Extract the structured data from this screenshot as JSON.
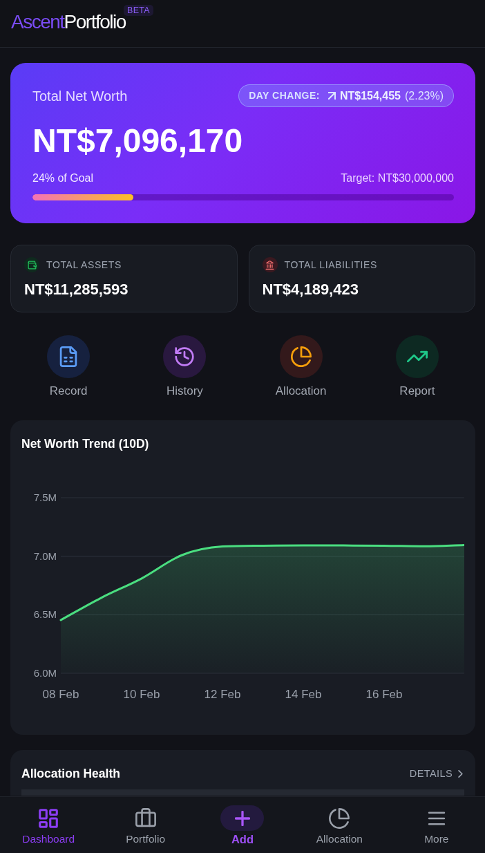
{
  "header": {
    "logo_words": [
      "Ascent",
      "Portfolio"
    ],
    "badge": "BETA"
  },
  "net_worth_card": {
    "label": "Total Net Worth",
    "day_change": {
      "label": "DAY CHANGE:",
      "amount": "NT$154,455",
      "percent": "(2.23%)"
    },
    "value": "NT$7,096,170",
    "goal_label": "24% of Goal",
    "target": "Target: NT$30,000,000",
    "progress": {
      "level": 0.24
    }
  },
  "summary_cards": [
    {
      "kind": "assets",
      "label": "TOTAL ASSETS",
      "value": "NT$11,285,593"
    },
    {
      "kind": "liabilities",
      "label": "TOTAL LIABILITIES",
      "value": "NT$4,189,423"
    }
  ],
  "quick_actions": [
    {
      "kind": "record",
      "label": "Record"
    },
    {
      "kind": "history",
      "label": "History"
    },
    {
      "kind": "allocation",
      "label": "Allocation"
    },
    {
      "kind": "report",
      "label": "Report"
    }
  ],
  "trend_card": {
    "chart_data": {
      "type": "area",
      "title": "Net Worth Trend (10D)",
      "categories": [
        "08 Feb",
        null,
        "10 Feb",
        null,
        "12 Feb",
        null,
        "14 Feb",
        null,
        "16 Feb",
        null,
        null
      ],
      "series": [
        {
          "color": "#4ade80",
          "values": [
            6.455,
            6.645,
            6.81,
            7.01,
            7.083,
            7.09,
            7.092,
            7.092,
            7.09,
            7.085,
            7.096
          ]
        }
      ],
      "ylim": [
        6,
        7.5
      ],
      "yticks": [
        {
          "value": 6,
          "label": "6.0M"
        },
        {
          "value": 6.5,
          "label": "6.5M"
        },
        {
          "value": 7,
          "label": "7.0M"
        },
        {
          "value": 7.5,
          "label": "7.5M"
        }
      ]
    }
  },
  "allocation_card": {
    "title": "Allocation Health",
    "link": "DETAILS"
  },
  "bottom_nav": [
    {
      "kind": "dashboard",
      "label": "Dashboard",
      "selected": true
    },
    {
      "kind": "portfolio",
      "label": "Portfolio",
      "selected": false
    },
    {
      "kind": "add",
      "label": "Add",
      "selected": false
    },
    {
      "kind": "allocation",
      "label": "Allocation",
      "selected": false
    },
    {
      "kind": "more",
      "label": "More",
      "selected": false
    }
  ]
}
